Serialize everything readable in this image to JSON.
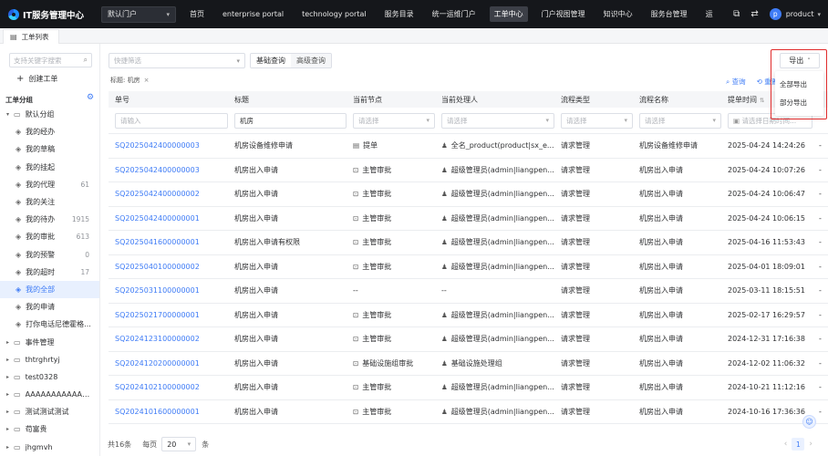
{
  "header": {
    "logo_text": "IT服务管理中心",
    "portal_select": "默认门户",
    "nav": [
      "首页",
      "enterprise portal",
      "technology portal",
      "服务目录",
      "统一运维门户",
      "工单中心",
      "门户视图管理",
      "知识中心",
      "服务台管理",
      "运"
    ],
    "active_nav_index": 5,
    "avatar_letter": "p",
    "user_name": "product"
  },
  "tabs": {
    "active_tab": "工单列表"
  },
  "sidebar": {
    "search_placeholder": "支持关键字搜索",
    "create_label": "创建工单",
    "section_title": "工单分组",
    "tree": [
      {
        "label": "默认分组",
        "type": "folder",
        "expanded": true
      },
      {
        "label": "我的经办",
        "type": "item"
      },
      {
        "label": "我的草稿",
        "type": "item"
      },
      {
        "label": "我的挂起",
        "type": "item"
      },
      {
        "label": "我的代理",
        "type": "item",
        "count": "61"
      },
      {
        "label": "我的关注",
        "type": "item"
      },
      {
        "label": "我的待办",
        "type": "item",
        "count": "1915"
      },
      {
        "label": "我的审批",
        "type": "item",
        "count": "613"
      },
      {
        "label": "我的预警",
        "type": "item",
        "count": "0"
      },
      {
        "label": "我的超时",
        "type": "item",
        "count": "17"
      },
      {
        "label": "我的全部",
        "type": "item",
        "active": true
      },
      {
        "label": "我的申请",
        "type": "item"
      },
      {
        "label": "打你电话尼德霍格...",
        "type": "item"
      },
      {
        "label": "事件管理",
        "type": "folder"
      },
      {
        "label": "thtrghrtyj",
        "type": "folder"
      },
      {
        "label": "test0328",
        "type": "folder"
      },
      {
        "label": "AAAAAAAAAAAAA...",
        "type": "folder"
      },
      {
        "label": "测试测试测试",
        "type": "folder"
      },
      {
        "label": "苟富贵",
        "type": "folder"
      },
      {
        "label": "jhgmvh",
        "type": "folder"
      }
    ]
  },
  "toolbar": {
    "quick_filter_placeholder": "快捷筛选",
    "basic_query": "基础查询",
    "advanced_query": "高级查询",
    "tag_label": "标题: 机房",
    "export_label": "导出",
    "query_link": "查询",
    "reset_link": "重置"
  },
  "export_menu": {
    "all": "全部导出",
    "partial": "部分导出"
  },
  "table": {
    "columns": [
      "单号",
      "标题",
      "当前节点",
      "当前处理人",
      "流程类型",
      "流程名称",
      "提单时间"
    ],
    "filters": {
      "number_placeholder": "请输入",
      "title_value": "机房",
      "select_placeholder": "请选择",
      "date_placeholder": "请选择日期时间..."
    },
    "rows": [
      {
        "id": "SQ2025042400000003",
        "title": "机房设备维修申请",
        "node": "提单",
        "node_icon": "doc-icon",
        "handler": "全名_product(product|sx_e...",
        "type": "请求管理",
        "flow": "机房设备维修申请",
        "time": "2025-04-24 14:24:26"
      },
      {
        "id": "SQ2025042400000003",
        "title": "机房出入申请",
        "node": "主管审批",
        "node_icon": "lock-icon",
        "handler": "超级管理员(admin|liangpen...",
        "type": "请求管理",
        "flow": "机房出入申请",
        "time": "2025-04-24 10:07:26"
      },
      {
        "id": "SQ2025042400000002",
        "title": "机房出入申请",
        "node": "主管审批",
        "node_icon": "lock-icon",
        "handler": "超级管理员(admin|liangpen...",
        "type": "请求管理",
        "flow": "机房出入申请",
        "time": "2025-04-24 10:06:47"
      },
      {
        "id": "SQ2025042400000001",
        "title": "机房出入申请",
        "node": "主管审批",
        "node_icon": "lock-icon",
        "handler": "超级管理员(admin|liangpen...",
        "type": "请求管理",
        "flow": "机房出入申请",
        "time": "2025-04-24 10:06:15"
      },
      {
        "id": "SQ2025041600000001",
        "title": "机房出入申请有权限",
        "node": "主管审批",
        "node_icon": "lock-icon",
        "handler": "超级管理员(admin|liangpen...",
        "type": "请求管理",
        "flow": "机房出入申请",
        "time": "2025-04-16 11:53:43"
      },
      {
        "id": "SQ2025040100000002",
        "title": "机房出入申请",
        "node": "主管审批",
        "node_icon": "lock-icon",
        "handler": "超级管理员(admin|liangpen...",
        "type": "请求管理",
        "flow": "机房出入申请",
        "time": "2025-04-01 18:09:01"
      },
      {
        "id": "SQ2025031100000001",
        "title": "机房出入申请",
        "node": "--",
        "node_icon": "",
        "handler": "--",
        "type": "请求管理",
        "flow": "机房出入申请",
        "time": "2025-03-11 18:15:51"
      },
      {
        "id": "SQ2025021700000001",
        "title": "机房出入申请",
        "node": "主管审批",
        "node_icon": "lock-icon",
        "handler": "超级管理员(admin|liangpen...",
        "type": "请求管理",
        "flow": "机房出入申请",
        "time": "2025-02-17 16:29:57"
      },
      {
        "id": "SQ2024123100000002",
        "title": "机房出入申请",
        "node": "主管审批",
        "node_icon": "lock-icon",
        "handler": "超级管理员(admin|liangpen...",
        "type": "请求管理",
        "flow": "机房出入申请",
        "time": "2024-12-31 17:16:38"
      },
      {
        "id": "SQ2024120200000001",
        "title": "机房出入申请",
        "node": "基础设施组审批",
        "node_icon": "lock-icon",
        "handler": "基础设施处理组",
        "type": "请求管理",
        "flow": "机房出入申请",
        "time": "2024-12-02 11:06:32"
      },
      {
        "id": "SQ2024102100000002",
        "title": "机房出入申请",
        "node": "主管审批",
        "node_icon": "lock-icon",
        "handler": "超级管理员(admin|liangpen...",
        "type": "请求管理",
        "flow": "机房出入申请",
        "time": "2024-10-21 11:12:16"
      },
      {
        "id": "SQ2024101600000001",
        "title": "机房出入申请",
        "node": "主管审批",
        "node_icon": "lock-icon",
        "handler": "超级管理员(admin|liangpen...",
        "type": "请求管理",
        "flow": "机房出入申请",
        "time": "2024-10-16 17:36:36"
      }
    ]
  },
  "footer": {
    "total": "共16条",
    "per_page_label": "每页",
    "page_size": "20",
    "unit": "条",
    "current_page": "1"
  },
  "colors": {
    "accent": "#3f7cf6",
    "topbar": "#15171b",
    "highlight_border": "#e02b2b"
  }
}
